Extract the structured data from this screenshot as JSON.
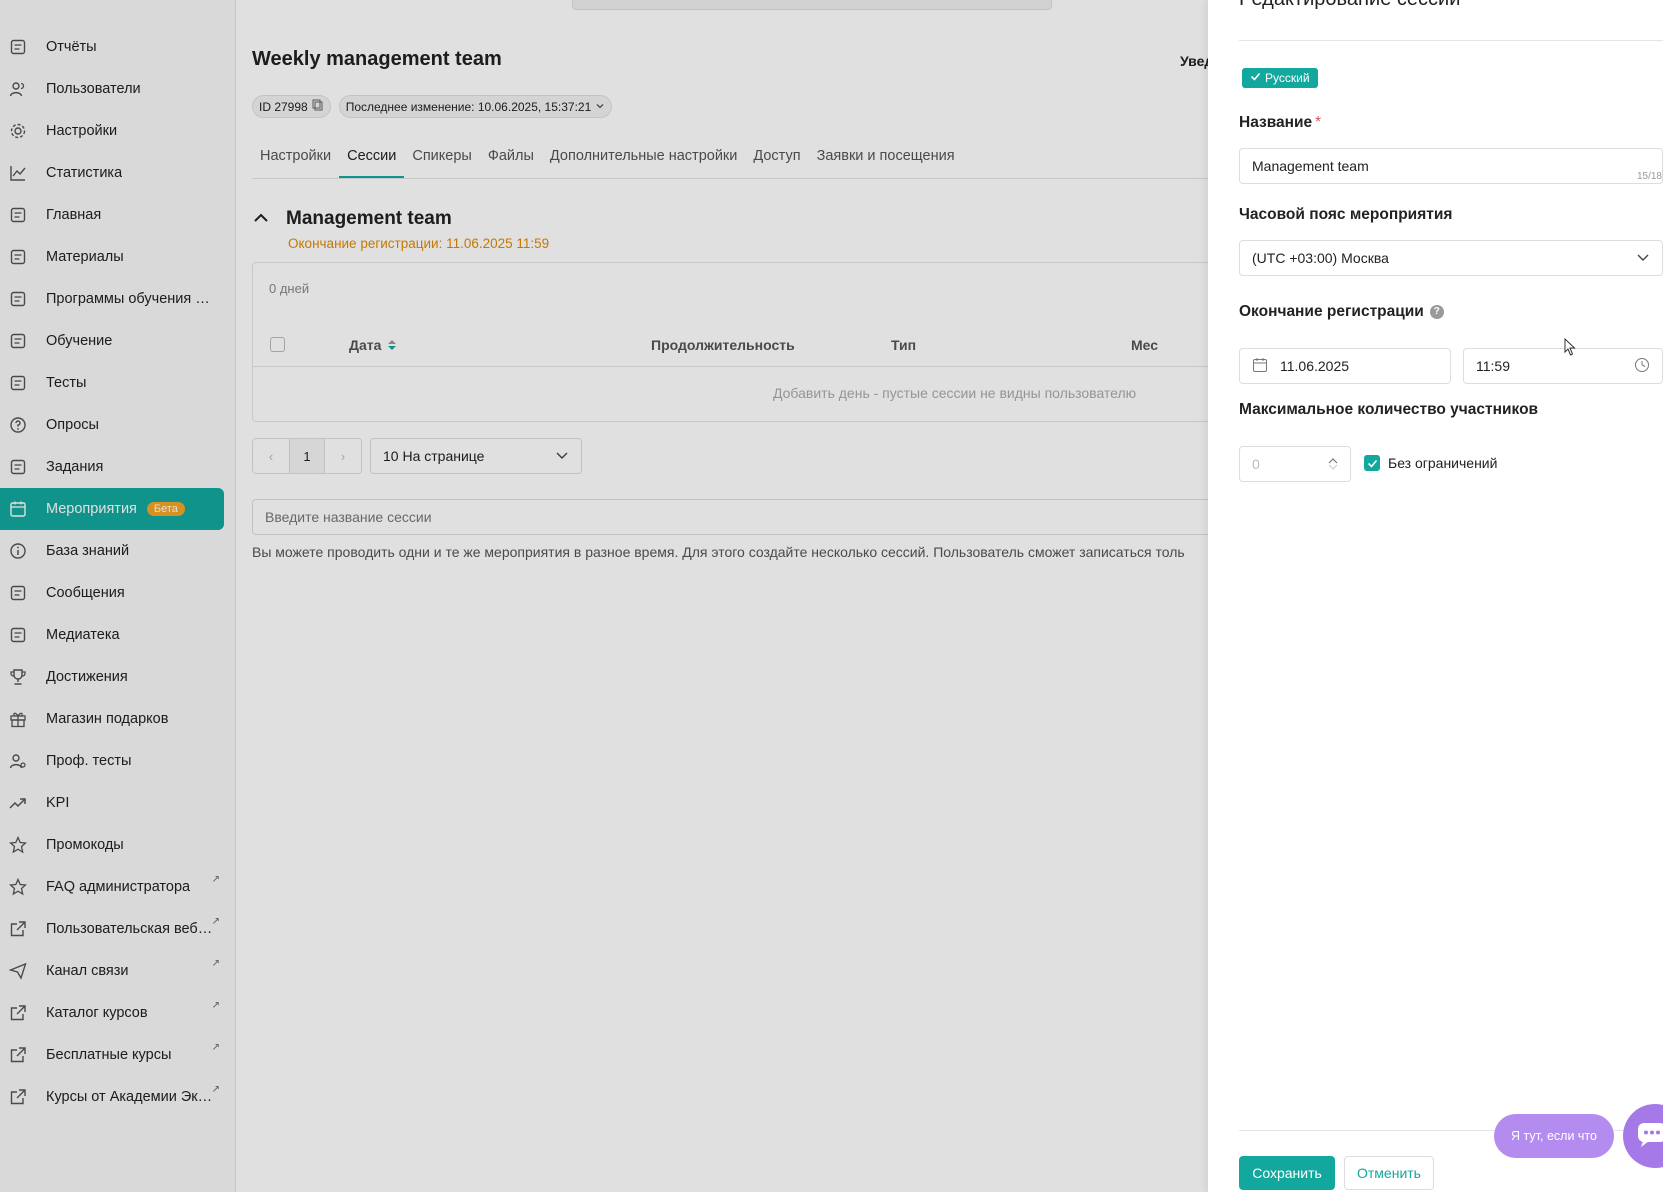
{
  "sidebar": {
    "items": [
      {
        "label": "Отчёты",
        "icon": "reports-icon"
      },
      {
        "label": "Пользователи",
        "icon": "users-icon"
      },
      {
        "label": "Настройки",
        "icon": "gear-icon"
      },
      {
        "label": "Статистика",
        "icon": "chart-icon"
      },
      {
        "label": "Главная",
        "icon": "home-icon"
      },
      {
        "label": "Материалы",
        "icon": "materials-icon"
      },
      {
        "label": "Программы обучения п...",
        "icon": "programs-icon"
      },
      {
        "label": "Обучение",
        "icon": "learning-icon"
      },
      {
        "label": "Тесты",
        "icon": "tests-icon"
      },
      {
        "label": "Опросы",
        "icon": "survey-icon"
      },
      {
        "label": "Задания",
        "icon": "tasks-icon"
      },
      {
        "label": "Мероприятия",
        "icon": "calendar-icon",
        "badge": "Бета",
        "active": true
      },
      {
        "label": "База знаний",
        "icon": "info-icon"
      },
      {
        "label": "Сообщения",
        "icon": "messages-icon"
      },
      {
        "label": "Медиатека",
        "icon": "media-icon"
      },
      {
        "label": "Достижения",
        "icon": "trophy-icon"
      },
      {
        "label": "Магазин подарков",
        "icon": "gift-icon"
      },
      {
        "label": "Проф. тесты",
        "icon": "prof-tests-icon"
      },
      {
        "label": "KPI",
        "icon": "trend-icon"
      },
      {
        "label": "Промокоды",
        "icon": "star-icon"
      },
      {
        "label": "FAQ администратора",
        "icon": "star-icon",
        "external": true
      },
      {
        "label": "Пользовательская веб-...",
        "icon": "external-link-icon",
        "external": true
      },
      {
        "label": "Канал связи",
        "icon": "send-icon",
        "external": true
      },
      {
        "label": "Каталог курсов",
        "icon": "external-link-icon",
        "external": true
      },
      {
        "label": "Бесплатные курсы",
        "icon": "external-link-icon",
        "external": true
      },
      {
        "label": "Курсы от Академии Экв...",
        "icon": "external-link-icon",
        "external": true
      }
    ],
    "external_mark": "↗"
  },
  "main": {
    "title": "Weekly management team",
    "notify_text": "Увед",
    "id_chip": "ID 27998",
    "last_change": "Последнее изменение: 10.06.2025, 15:37:21",
    "tabs": [
      "Настройки",
      "Сессии",
      "Спикеры",
      "Файлы",
      "Дополнительные настройки",
      "Доступ",
      "Заявки и посещения"
    ],
    "active_tab": "Сессии",
    "session": {
      "title": "Management team",
      "reg_end": "Окончание регистрации: 11.06.2025 11:59",
      "days": "0 дней",
      "columns": [
        "Дата",
        "Продолжительность",
        "Тип",
        "Мес"
      ],
      "empty_text": "Добавить день - пустые сессии не видны пользователю"
    },
    "pager": {
      "page": "1",
      "prev": "‹",
      "next": "›",
      "per_page": "10 На странице"
    },
    "session_placeholder": "Введите название сессии",
    "hint": "Вы можете проводить одни и те же мероприятия в разное время. Для этого создайте несколько сессий. Пользователь сможет записаться толь"
  },
  "drawer": {
    "title": "Редактирование сессии",
    "language": "Русский",
    "name_label": "Название",
    "required_mark": "*",
    "name_value": "Management team",
    "name_counter": "15/18",
    "tz_label": "Часовой пояс мероприятия",
    "tz_value": "(UTC +03:00) Москва",
    "reg_end_label": "Окончание регистрации",
    "help_mark": "?",
    "reg_date": "11.06.2025",
    "reg_time": "11:59",
    "max_label": "Максимальное количество участников",
    "max_value": "0",
    "no_limit_label": "Без ограничений",
    "save": "Сохранить",
    "cancel": "Отменить"
  },
  "chat": {
    "bubble": "Я тут, если что"
  },
  "colors": {
    "accent": "#13a89e",
    "warning": "#e08a00",
    "chat": "#b48cf0"
  }
}
